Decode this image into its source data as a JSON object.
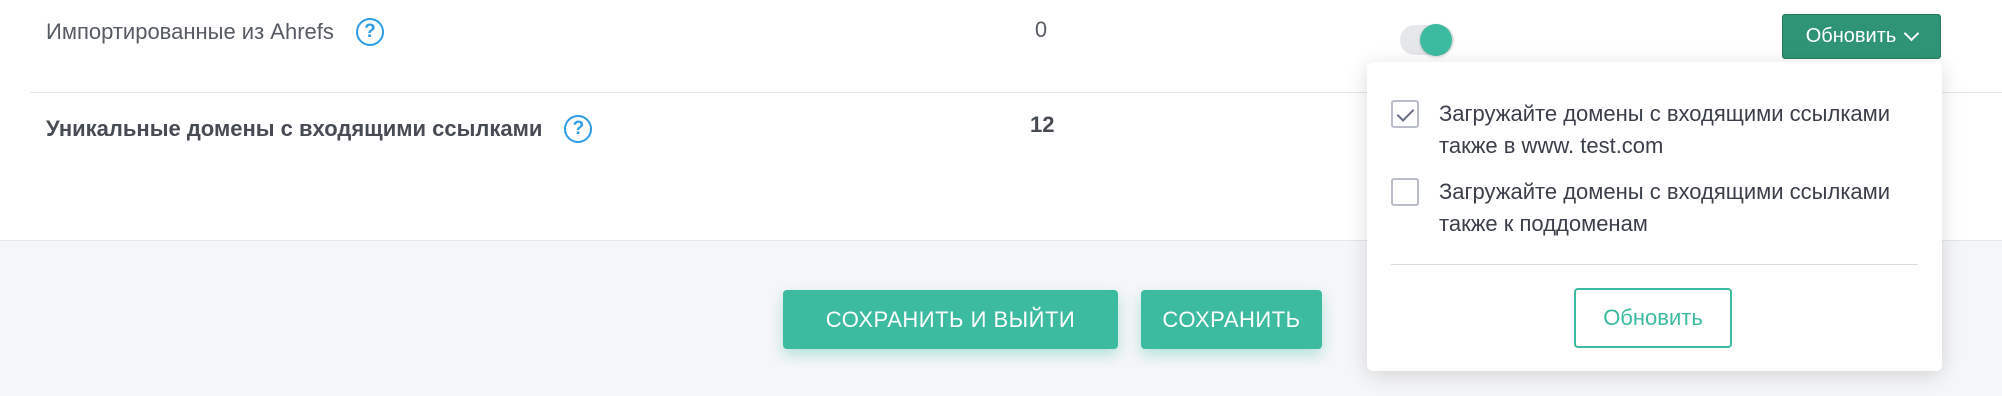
{
  "rows": [
    {
      "label": "Импортированные из Ahrefs",
      "value": "0"
    },
    {
      "label": "Уникальные домены с входящими ссылками",
      "value": "12"
    }
  ],
  "help_glyph": "?",
  "toggle": {
    "state": "on",
    "color": "#3cbba0"
  },
  "update_dropdown": {
    "label": "Обновить",
    "color": "#2f9476"
  },
  "popup": {
    "options": [
      {
        "line1": "Загружайте домены с входящими ссылками",
        "line2": "также в www. test.com",
        "checked": true
      },
      {
        "line1": "Загружайте домены с входящими ссылками",
        "line2": "также к поддоменам",
        "checked": false
      }
    ],
    "button_label": "Обновить"
  },
  "footer": {
    "save_exit_label": "СОХРАНИТЬ И ВЫЙТИ",
    "save_label": "СОХРАНИТЬ"
  },
  "accent_color": "#3cbba0"
}
